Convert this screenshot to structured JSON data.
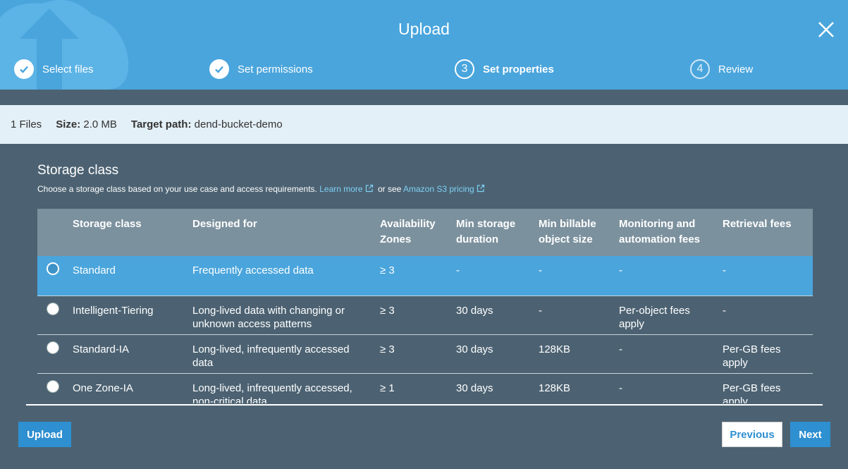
{
  "header": {
    "title": "Upload",
    "steps": [
      {
        "number": "",
        "label": "Select files",
        "state": "done"
      },
      {
        "number": "",
        "label": "Set permissions",
        "state": "done"
      },
      {
        "number": "3",
        "label": "Set properties",
        "state": "active"
      },
      {
        "number": "4",
        "label": "Review",
        "state": "future"
      }
    ]
  },
  "info": {
    "files": "1 Files",
    "size_label": "Size:",
    "size_value": "2.0 MB",
    "target_label": "Target path:",
    "target_value": "dend-bucket-demo"
  },
  "storage": {
    "title": "Storage class",
    "description": "Choose a storage class based on your use case and access requirements.",
    "learn_more": "Learn more",
    "or_see": "or see",
    "pricing_link": "Amazon S3 pricing"
  },
  "table": {
    "headers": [
      "Storage class",
      "Designed for",
      "Availability Zones",
      "Min storage duration",
      "Min billable object size",
      "Monitoring and automation fees",
      "Retrieval fees"
    ],
    "rows": [
      {
        "selected": true,
        "cells": [
          "Standard",
          "Frequently accessed data",
          "≥ 3",
          "-",
          "-",
          "-",
          "-"
        ]
      },
      {
        "selected": false,
        "cells": [
          "Intelligent-Tiering",
          "Long-lived data with changing or unknown access patterns",
          "≥ 3",
          "30 days",
          "-",
          "Per-object fees apply",
          "-"
        ]
      },
      {
        "selected": false,
        "cells": [
          "Standard-IA",
          "Long-lived, infrequently accessed data",
          "≥ 3",
          "30 days",
          "128KB",
          "-",
          "Per-GB fees apply"
        ]
      },
      {
        "selected": false,
        "cells": [
          "One Zone-IA",
          "Long-lived, infrequently accessed, non-critical data",
          "≥ 1",
          "30 days",
          "128KB",
          "-",
          "Per-GB fees apply"
        ]
      }
    ]
  },
  "footer": {
    "upload_label": "Upload",
    "previous_label": "Previous",
    "next_label": "Next"
  },
  "colors": {
    "header_blue": "#4aa5dc",
    "body_slate": "#4c6272",
    "table_header": "#7c919e",
    "info_bar": "#e4f0f7",
    "link": "#7fd0f5",
    "button_blue": "#2e8fd1"
  },
  "icons": {
    "close": "close-icon",
    "check": "check-icon",
    "external_link": "external-link-icon",
    "logo": "cloud-upload-logo-icon"
  }
}
